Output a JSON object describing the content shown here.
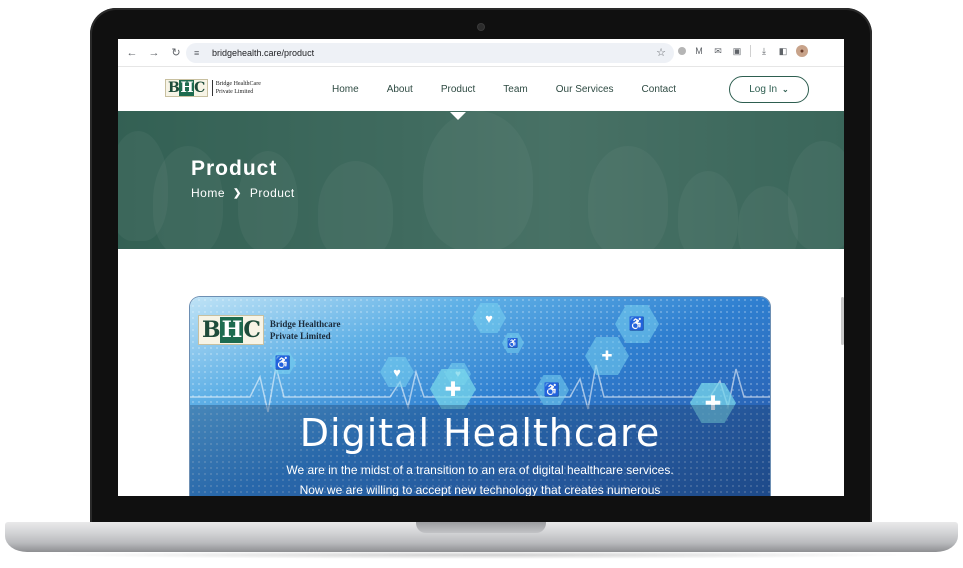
{
  "browser": {
    "url": "bridgehealth.care/product",
    "back_icon": "arrow-left-icon",
    "forward_icon": "arrow-right-icon",
    "reload_icon": "reload-icon"
  },
  "site": {
    "logo_mark": "BHC",
    "logo_line1": "Bridge HealthCare",
    "logo_line2": "Private Limited",
    "nav": [
      "Home",
      "About",
      "Product",
      "Team",
      "Our Services",
      "Contact"
    ],
    "active_nav": "Product",
    "login_label": "Log In"
  },
  "hero": {
    "title": "Product",
    "breadcrumb_home": "Home",
    "breadcrumb_current": "Product"
  },
  "banner": {
    "logo_mark": "BHC",
    "logo_line1": "Bridge Healthcare",
    "logo_line2": "Private Limited",
    "title": "Digital Healthcare",
    "line1": "We are in the midst of a transition to an era of digital healthcare services.",
    "line2": "Now we are willing to accept new technology that creates numerous"
  },
  "colors": {
    "brand_green": "#2e5e50",
    "hero_overlay": "#295548",
    "banner_blue": "#2f7fd0"
  }
}
